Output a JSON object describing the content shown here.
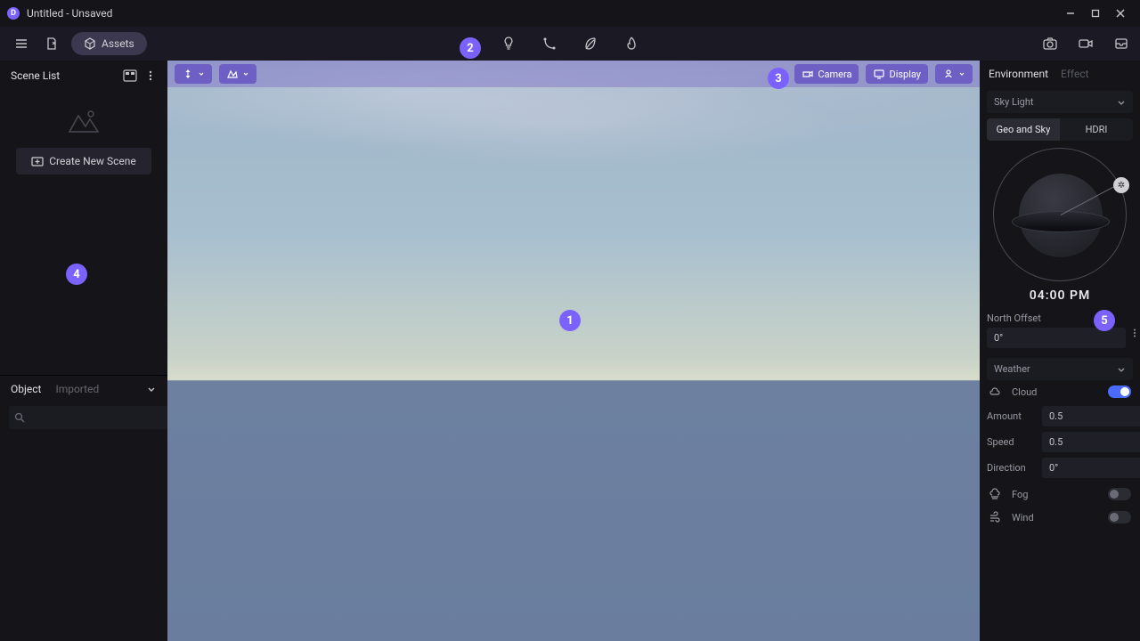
{
  "titlebar": {
    "title": "Untitled - Unsaved"
  },
  "toolbar": {
    "assets_label": "Assets"
  },
  "left": {
    "scene_list_title": "Scene List",
    "create_scene_label": "Create New Scene",
    "object_tab": "Object",
    "imported_tab": "Imported",
    "search_placeholder": ""
  },
  "viewport": {
    "camera_label": "Camera",
    "display_label": "Display"
  },
  "right": {
    "env_tab": "Environment",
    "effect_tab": "Effect",
    "sky_light": {
      "title": "Sky Light",
      "geo_sky": "Geo and Sky",
      "hdri": "HDRI",
      "time": "04:00 PM",
      "north_offset_label": "North Offset",
      "north_offset_value": "0°"
    },
    "weather": {
      "title": "Weather",
      "cloud_label": "Cloud",
      "cloud_on": true,
      "amount_label": "Amount",
      "amount_value": "0.5",
      "speed_label": "Speed",
      "speed_value": "0.5",
      "direction_label": "Direction",
      "direction_value": "0°",
      "fog_label": "Fog",
      "fog_on": false,
      "wind_label": "Wind",
      "wind_on": false
    }
  },
  "badges": [
    "1",
    "2",
    "3",
    "4",
    "5"
  ]
}
